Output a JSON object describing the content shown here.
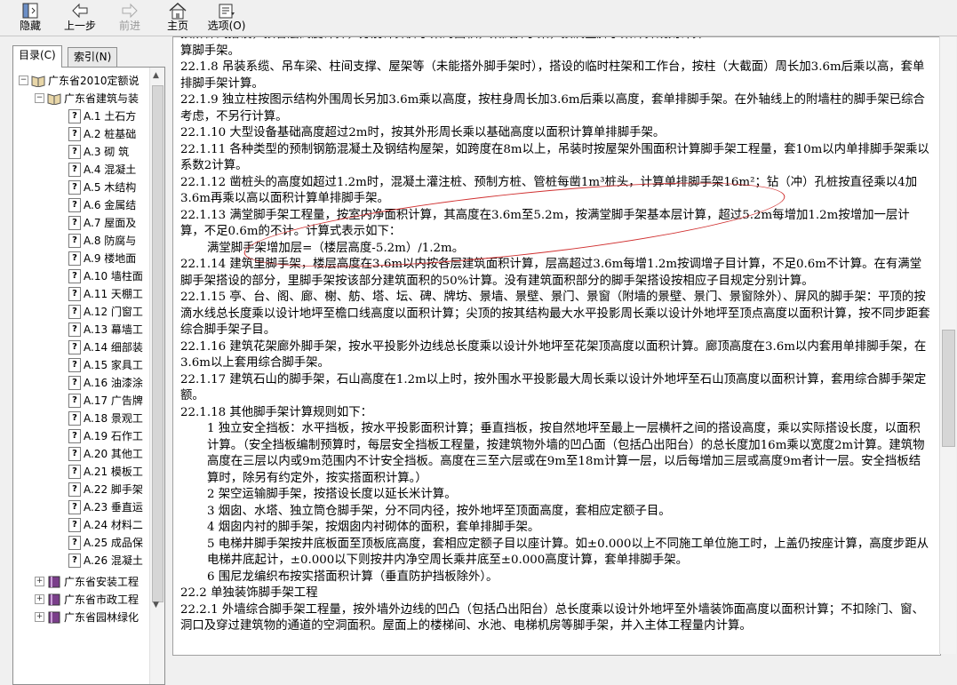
{
  "toolbar": {
    "hide": "隐藏",
    "back": "上一步",
    "forward": "前进",
    "home": "主页",
    "options": "选项(O)"
  },
  "tabs": {
    "contents": "目录(C)",
    "index": "索引(N)"
  },
  "tree": [
    {
      "type": "root",
      "label": "广东省2010定额说"
    },
    {
      "type": "book",
      "label": "广东省建筑与装"
    },
    {
      "type": "page",
      "label": "A.1  土石方"
    },
    {
      "type": "page",
      "label": "A.2  桩基础"
    },
    {
      "type": "page",
      "label": "A.3  砌  筑"
    },
    {
      "type": "page",
      "label": "A.4  混凝土"
    },
    {
      "type": "page",
      "label": "A.5  木结构"
    },
    {
      "type": "page",
      "label": "A.6  金属结"
    },
    {
      "type": "page",
      "label": "A.7  屋面及"
    },
    {
      "type": "page",
      "label": "A.8  防腐与"
    },
    {
      "type": "page",
      "label": "A.9  楼地面"
    },
    {
      "type": "page",
      "label": "A.10  墙柱面"
    },
    {
      "type": "page",
      "label": "A.11  天棚工"
    },
    {
      "type": "page",
      "label": "A.12  门窗工"
    },
    {
      "type": "page",
      "label": "A.13  幕墙工"
    },
    {
      "type": "page",
      "label": "A.14  细部装"
    },
    {
      "type": "page",
      "label": "A.15  家具工"
    },
    {
      "type": "page",
      "label": "A.16  油漆涂"
    },
    {
      "type": "page",
      "label": "A.17  广告牌"
    },
    {
      "type": "page",
      "label": "A.18  景观工"
    },
    {
      "type": "page",
      "label": "A.19  石作工"
    },
    {
      "type": "page",
      "label": "A.20  其他工"
    },
    {
      "type": "page",
      "label": "A.21  模板工"
    },
    {
      "type": "page",
      "label": "A.22  脚手架"
    },
    {
      "type": "page",
      "label": "A.23  垂直运"
    },
    {
      "type": "page",
      "label": "A.24  材料二"
    },
    {
      "type": "page",
      "label": "A.25  成品保"
    },
    {
      "type": "page",
      "label": "A.26  混凝土"
    },
    {
      "type": "book2",
      "label": "广东省安装工程"
    },
    {
      "type": "book2",
      "label": "广东省市政工程"
    },
    {
      "type": "book2",
      "label": "广东省园林绿化"
    }
  ],
  "content": [
    {
      "t": "按阶梯式搭设，按各层高度计算，分别计算脚手架的面积，架高脚手架，按满堂脚手架计算规则计算",
      "c": false,
      "i": false
    },
    {
      "t": "算脚手架。",
      "c": false,
      "i": false
    },
    {
      "t": "22.1.8  吊装系缆、吊车梁、柱间支撑、屋架等（未能搭外脚手架时），搭设的临时柱架和工作台，按柱（大截面）周长加3.6m后乘以高，套单排脚手架计算。",
      "c": false,
      "i": false
    },
    {
      "t": "22.1.9  独立柱按图示结构外围周长另加3.6m乘以高度，按柱身周长加3.6m后乘以高度，套单排脚手架。在外轴线上的附墙柱的脚手架已综合考虑，不另行计算。",
      "c": false,
      "i": false
    },
    {
      "t": "22.1.10  大型设备基础高度超过2m时，按其外形周长乘以基础高度以面积计算单排脚手架。",
      "c": false,
      "i": false
    },
    {
      "t": "22.1.11  各种类型的预制钢筋混凝土及钢结构屋架，如跨度在8m以上，吊装时按屋架外围面积计算脚手架工程量，套10m以内单排脚手架乘以系数2计算。",
      "c": false,
      "i": false
    },
    {
      "t": "22.1.12  凿桩头的高度如超过1.2m时，混凝土灌注桩、预制方桩、管桩每凿1m³桩头，计算单排脚手架16m²；钻（冲）孔桩按直径乘以4加3.6m再乘以高以面积计算单排脚手架。",
      "c": false,
      "i": false
    },
    {
      "t": "22.1.13  满堂脚手架工程量，按室内净面积计算，其高度在3.6m至5.2m，按满堂脚手架基本层计算，超过5.2m每增加1.2m按增加一层计算，不足0.6m的不计。计算式表示如下：",
      "c": true,
      "i": false
    },
    {
      "t": "满堂脚手架增加层=（楼层高度-5.2m）/1.2m。",
      "c": false,
      "i": true
    },
    {
      "t": "22.1.14  建筑里脚手架，楼层高度在3.6m以内按各层建筑面积计算，层高超过3.6m每增1.2m按调增子目计算，不足0.6m不计算。在有满堂脚手架搭设的部分，里脚手架按该部分建筑面积的50%计算。没有建筑面积部分的脚手架搭设按相应子目规定分别计算。",
      "c": false,
      "i": false
    },
    {
      "t": "22.1.15  亭、台、阁、廊、榭、舫、塔、坛、碑、牌坊、景墙、景壁、景门、景窗（附墙的景壁、景门、景窗除外）、屏风的脚手架：平顶的按滴水线总长度乘以设计地坪至檐口线高度以面积计算；尖顶的按其结构最大水平投影周长乘以设计外地坪至顶点高度以面积计算，按不同步距套综合脚手架子目。",
      "c": false,
      "i": false
    },
    {
      "t": "22.1.16  建筑花架廊外脚手架，按水平投影外边线总长度乘以设计外地坪至花架顶高度以面积计算。廊顶高度在3.6m以内套用单排脚手架，在3.6m以上套用综合脚手架。",
      "c": false,
      "i": false
    },
    {
      "t": "22.1.17  建筑石山的脚手架，石山高度在1.2m以上时，按外围水平投影最大周长乘以设计外地坪至石山顶高度以面积计算，套用综合脚手架定额。",
      "c": false,
      "i": false
    },
    {
      "t": "22.1.18  其他脚手架计算规则如下：",
      "c": false,
      "i": false
    },
    {
      "t": "1  独立安全挡板：水平挡板，按水平投影面积计算；垂直挡板，按自然地坪至最上一层横杆之间的搭设高度，乘以实际搭设长度，以面积计算。（安全挡板编制预算时，每层安全挡板工程量，按建筑物外墙的凹凸面（包括凸出阳台）的总长度加16m乘以宽度2m计算。建筑物高度在三层以内或9m范围内不计安全挡板。高度在三至六层或在9m至18m计算一层，以后每增加三层或高度9m者计一层。安全挡板结算时，除另有约定外，按实搭面积计算。）",
      "c": false,
      "i": true
    },
    {
      "t": "2  架空运输脚手架，按搭设长度以延长米计算。",
      "c": false,
      "i": true
    },
    {
      "t": "3  烟囱、水塔、独立筒仓脚手架，分不同内径，按外地坪至顶面高度，套相应定额子目。",
      "c": false,
      "i": true
    },
    {
      "t": "4  烟囱内衬的脚手架，按烟囱内衬砌体的面积，套单排脚手架。",
      "c": false,
      "i": true
    },
    {
      "t": "5  电梯井脚手架按井底板面至顶板底高度，套相应定额子目以座计算。如±0.000以上不同施工单位施工时，上盖仍按座计算，高度步距从电梯井底起计，±0.000以下则按井内净空周长乘井底至±0.000高度计算，套单排脚手架。",
      "c": false,
      "i": true
    },
    {
      "t": "6  围尼龙编织布按实搭面积计算（垂直防护挡板除外）。",
      "c": false,
      "i": true
    },
    {
      "t": "22.2  单独装饰脚手架工程",
      "c": false,
      "i": false
    },
    {
      "t": "22.2.1  外墙综合脚手架工程量，按外墙外边线的凹凸（包括凸出阳台）总长度乘以设计外地坪至外墙装饰面高度以面积计算；不扣除门、窗、洞口及穿过建筑物的通道的空洞面积。屋面上的楼梯间、水池、电梯机房等脚手架，并入主体工程量内计算。",
      "c": false,
      "i": false
    }
  ]
}
